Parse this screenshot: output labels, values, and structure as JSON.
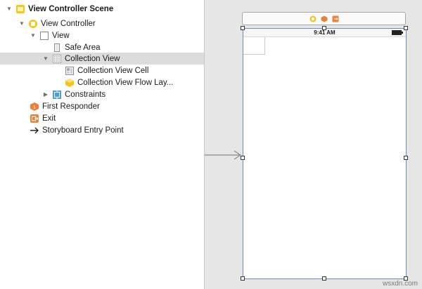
{
  "outline": {
    "items": [
      {
        "label": "View Controller Scene",
        "icon": "scene-icon",
        "disclosure": "expanded",
        "bold": true
      },
      {
        "label": "View Controller",
        "icon": "view-controller-icon",
        "disclosure": "expanded"
      },
      {
        "label": "View",
        "icon": "view-icon",
        "disclosure": "expanded"
      },
      {
        "label": "Safe Area",
        "icon": "safe-area-icon",
        "disclosure": "none"
      },
      {
        "label": "Collection View",
        "icon": "collection-view-icon",
        "disclosure": "expanded",
        "selected": true
      },
      {
        "label": "Collection View Cell",
        "icon": "collection-view-cell-icon",
        "disclosure": "none"
      },
      {
        "label": "Collection View Flow Lay...",
        "icon": "flow-layout-icon",
        "disclosure": "none"
      },
      {
        "label": "Constraints",
        "icon": "constraints-icon",
        "disclosure": "collapsed"
      },
      {
        "label": "First Responder",
        "icon": "first-responder-icon",
        "disclosure": "none"
      },
      {
        "label": "Exit",
        "icon": "exit-icon",
        "disclosure": "none"
      },
      {
        "label": "Storyboard Entry Point",
        "icon": "entry-point-arrow-icon",
        "disclosure": "none"
      }
    ]
  },
  "canvas": {
    "scene_dock_icons": [
      "view-controller-icon",
      "first-responder-icon",
      "exit-icon"
    ],
    "status_time": "9:41 AM",
    "watermark": "wsxdn.com"
  },
  "colors": {
    "selection": "#dcdcdc",
    "accent_yellow": "#f5c518",
    "accent_orange": "#e8823a",
    "device_border": "#6a8cc2"
  }
}
